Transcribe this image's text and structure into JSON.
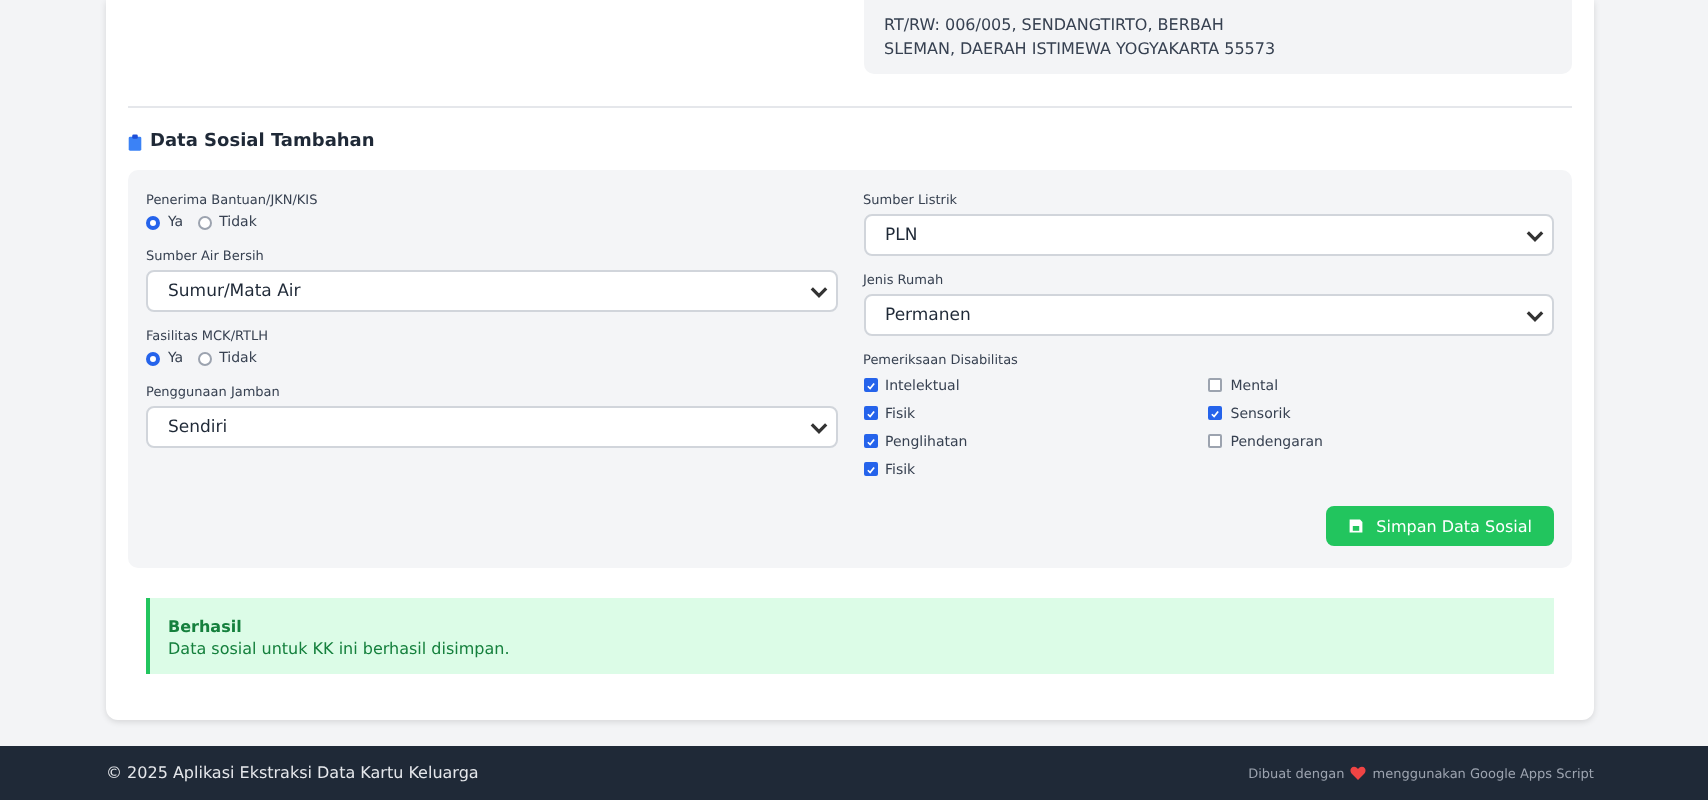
{
  "address": {
    "lines": [
      "RT/RW: 006/005, SENDANGTIRTO, BERBAH",
      "SLEMAN, DAERAH ISTIMEWA YOGYAKARTA 55573"
    ]
  },
  "section": {
    "title": "Data Sosial Tambahan"
  },
  "left_fields": [
    {
      "kind": "radio",
      "label": "Penerima Bantuan/JKN/KIS",
      "options": [
        {
          "label": "Ya",
          "selected": true
        },
        {
          "label": "Tidak",
          "selected": false
        }
      ]
    },
    {
      "kind": "select",
      "label": "Sumber Air Bersih",
      "value": "Sumur/Mata Air"
    },
    {
      "kind": "radio",
      "label": "Fasilitas MCK/RTLH",
      "options": [
        {
          "label": "Ya",
          "selected": true
        },
        {
          "label": "Tidak",
          "selected": false
        }
      ]
    },
    {
      "kind": "select",
      "label": "Penggunaan Jamban",
      "value": "Sendiri"
    }
  ],
  "right_fields": [
    {
      "kind": "select",
      "label": "Sumber Listrik",
      "value": "PLN"
    },
    {
      "kind": "select",
      "label": "Jenis Rumah",
      "value": "Permanen"
    }
  ],
  "disability": {
    "label": "Pemeriksaan Disabilitas",
    "options": [
      {
        "label": "Intelektual",
        "checked": true
      },
      {
        "label": "Mental",
        "checked": false
      },
      {
        "label": "Fisik",
        "checked": true
      },
      {
        "label": "Sensorik",
        "checked": true
      },
      {
        "label": "Penglihatan",
        "checked": true
      },
      {
        "label": "Pendengaran",
        "checked": false
      },
      {
        "label": "Fisik",
        "checked": true
      }
    ]
  },
  "save_button": "Simpan Data Sosial",
  "alert": {
    "title": "Berhasil",
    "message": "Data sosial untuk KK ini berhasil disimpan."
  },
  "footer": {
    "copyright": "© 2025 Aplikasi Ekstraksi Data Kartu Keluarga",
    "made_before": "Dibuat dengan",
    "made_after": "menggunakan Google Apps Script"
  }
}
